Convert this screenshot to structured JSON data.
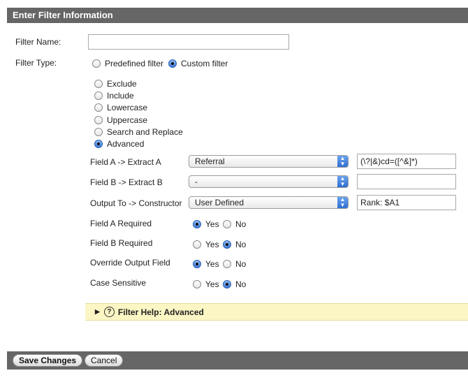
{
  "header": {
    "title": "Enter Filter Information"
  },
  "filter_name": {
    "label": "Filter Name:",
    "value": ""
  },
  "filter_type": {
    "label": "Filter Type:",
    "options": [
      "Predefined filter",
      "Custom filter"
    ],
    "selected": "Custom filter"
  },
  "custom_types": {
    "options": [
      "Exclude",
      "Include",
      "Lowercase",
      "Uppercase",
      "Search and Replace",
      "Advanced"
    ],
    "selected": "Advanced"
  },
  "fields": {
    "field_a": {
      "label": "Field A -> Extract A",
      "select": "Referral",
      "value": "(\\?|&)cd=([^&]*)"
    },
    "field_b": {
      "label": "Field B -> Extract B",
      "select": "-",
      "value": ""
    },
    "output": {
      "label": "Output To -> Constructor",
      "select": "User Defined",
      "value": "Rank: $A1"
    }
  },
  "options": {
    "yes_label": "Yes",
    "no_label": "No",
    "field_a_required": {
      "label": "Field A Required",
      "value": "Yes"
    },
    "field_b_required": {
      "label": "Field B Required",
      "value": "No"
    },
    "override_output": {
      "label": "Override Output Field",
      "value": "Yes"
    },
    "case_sensitive": {
      "label": "Case Sensitive",
      "value": "No"
    }
  },
  "help": {
    "label": "Filter Help: Advanced",
    "icon": "?"
  },
  "footer": {
    "save_label": "Save Changes",
    "cancel_label": "Cancel"
  }
}
